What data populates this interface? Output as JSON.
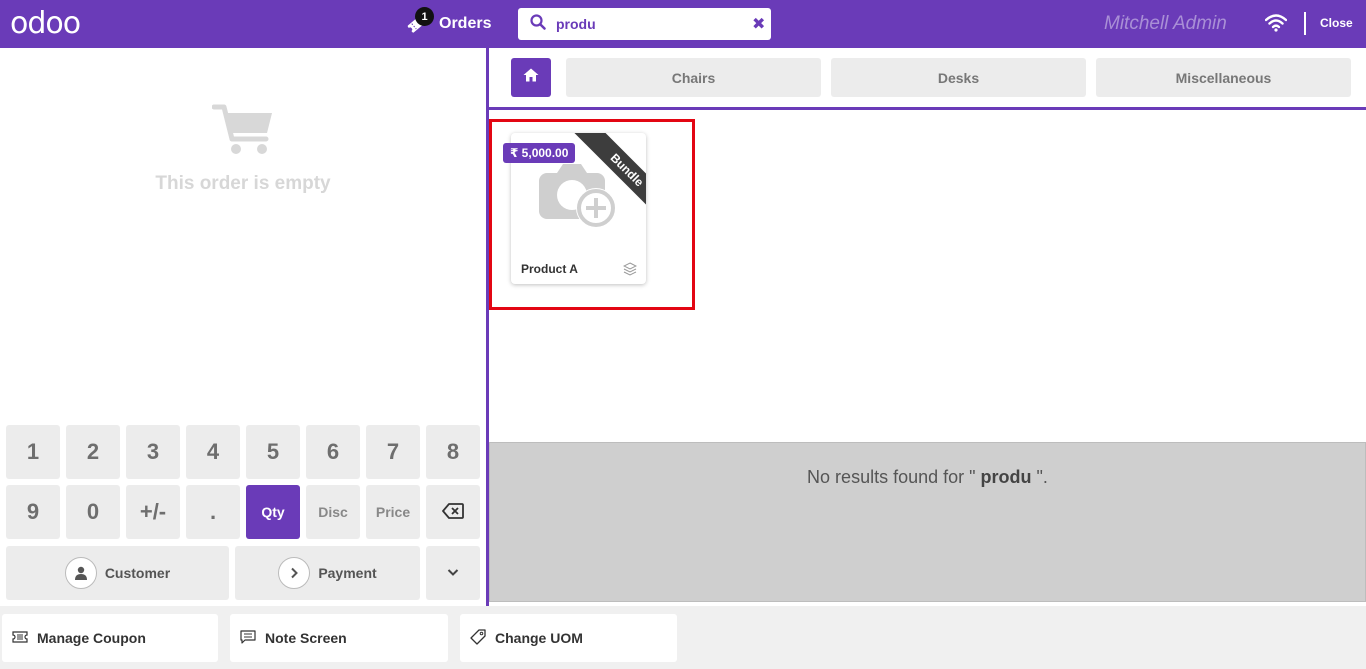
{
  "header": {
    "logo": "odoo",
    "orders_label": "Orders",
    "orders_count": "1",
    "search_value": "produ",
    "search_clear": "✖",
    "user_name": "Mitchell Admin",
    "close_label": "Close"
  },
  "order": {
    "empty_text": "This order is empty"
  },
  "numpad": {
    "keys": [
      "1",
      "2",
      "3",
      "4",
      "5",
      "6",
      "7",
      "8",
      "9",
      "0",
      "+/-",
      "."
    ],
    "qty": "Qty",
    "disc": "Disc",
    "price": "Price",
    "customer": "Customer",
    "payment": "Payment"
  },
  "categories": [
    "Chairs",
    "Desks",
    "Miscellaneous"
  ],
  "products": [
    {
      "name": "Product A",
      "price": "₹ 5,000.00",
      "ribbon": "Bundle"
    }
  ],
  "no_results": {
    "prefix": "No results found for \" ",
    "query": "produ",
    "suffix": " \"."
  },
  "control_buttons": [
    "Manage Coupon",
    "Note Screen",
    "Change UOM"
  ],
  "colors": {
    "brand": "#6a3bb8",
    "highlight": "#e30613",
    "ribbon": "#3d3d3d"
  },
  "icons": [
    "ticket-icon",
    "search-icon",
    "wifi-icon",
    "cart-icon",
    "home-icon",
    "camera-plus-icon",
    "layers-icon",
    "backspace-icon",
    "user-icon",
    "chevron-right-icon",
    "chevron-down-icon",
    "coupon-icon",
    "note-icon",
    "tag-icon"
  ]
}
